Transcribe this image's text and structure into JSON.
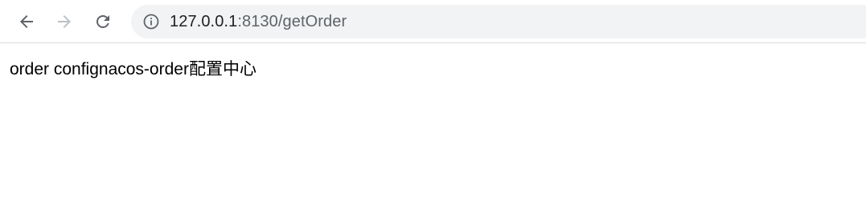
{
  "browser": {
    "nav": {
      "back_icon": "arrow-left-icon",
      "forward_icon": "arrow-right-icon",
      "reload_icon": "reload-icon"
    },
    "address_bar": {
      "security_icon": "info-icon",
      "url_host": "127.0.0.1",
      "url_path": ":8130/getOrder"
    }
  },
  "page": {
    "body_text": "order confignacos-order配置中心"
  },
  "colors": {
    "toolbar_bg": "#ffffff",
    "omnibox_bg": "#f1f3f4",
    "icon_active": "#5f6368",
    "icon_disabled": "#bdc1c6",
    "url_host": "#202124",
    "url_path": "#5f6368"
  }
}
